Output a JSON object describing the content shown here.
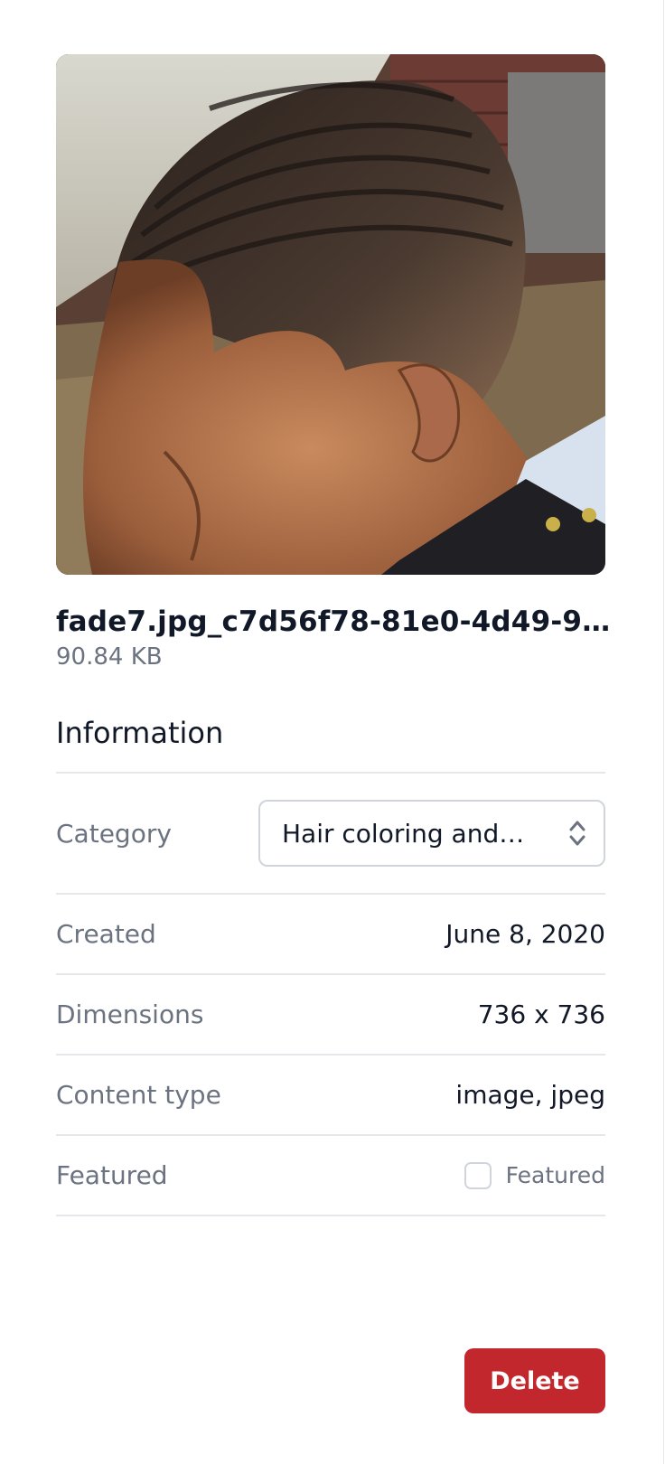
{
  "file": {
    "name": "fade7.jpg_c7d56f78-81e0-4d49-970d-…",
    "size": "90.84 KB",
    "preview_icon": "image-preview"
  },
  "info": {
    "title": "Information",
    "category": {
      "label": "Category",
      "selected": "Hair coloring and …"
    },
    "created": {
      "label": "Created",
      "value": "June 8, 2020"
    },
    "dimensions": {
      "label": "Dimensions",
      "value": "736 x 736"
    },
    "content_type": {
      "label": "Content type",
      "value": "image, jpeg"
    },
    "featured": {
      "label": "Featured",
      "checkbox_label": "Featured",
      "checked": false
    }
  },
  "actions": {
    "delete_label": "Delete"
  },
  "colors": {
    "danger": "#c1272d",
    "muted_text": "#6b7280",
    "border": "#e5e7eb"
  }
}
